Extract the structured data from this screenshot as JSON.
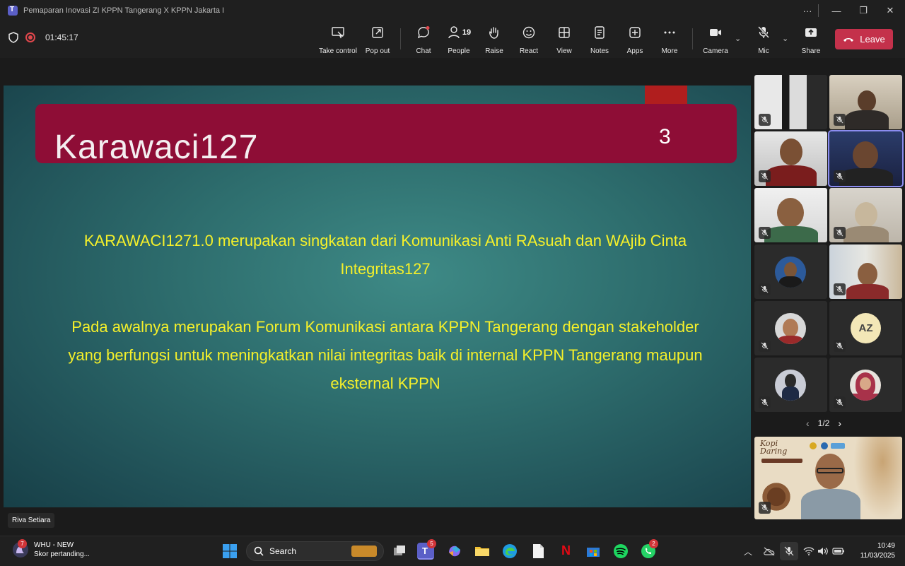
{
  "window": {
    "title": "Pemaparan Inovasi ZI KPPN Tangerang X KPPN Jakarta I",
    "more": "···",
    "minimize": "—",
    "maximize": "❐",
    "close": "✕"
  },
  "meeting": {
    "timer": "01:45:17",
    "people_count": "19",
    "buttons": {
      "take_control": "Take control",
      "pop_out": "Pop out",
      "chat": "Chat",
      "people": "People",
      "raise": "Raise",
      "react": "React",
      "view": "View",
      "notes": "Notes",
      "apps": "Apps",
      "more": "More",
      "camera": "Camera",
      "mic": "Mic",
      "share": "Share",
      "leave": "Leave"
    }
  },
  "slide": {
    "title": "Karawaci127",
    "number": "3",
    "paragraph1": "KARAWACI1271.0 merupakan singkatan dari Komunikasi Anti RAsuah dan WAjib Cinta Integritas127",
    "paragraph2": "Pada awalnya merupakan Forum Komunikasi antara KPPN Tangerang dengan stakeholder yang berfungsi untuk meningkatkan nilai integritas baik di internal KPPN Tangerang maupun eksternal KPPN"
  },
  "presenter_name": "Riva Setiara",
  "participants": {
    "avatar_initials": "AZ",
    "pager": "1/2"
  },
  "featured_tile": {
    "banner_text": "Kopi Daring"
  },
  "taskbar": {
    "news_badge": "7",
    "news_title": "WHU - NEW",
    "news_subtitle": "Skor pertanding...",
    "search_label": "Search",
    "teams_badge": "5",
    "whatsapp_badge": "2",
    "time": "10:49",
    "date": "11/03/2025"
  },
  "colors": {
    "leave": "#c4314b",
    "slide_banner": "#8e0d36",
    "slide_text": "#f5f02a",
    "accent": "#8b8cf0"
  }
}
